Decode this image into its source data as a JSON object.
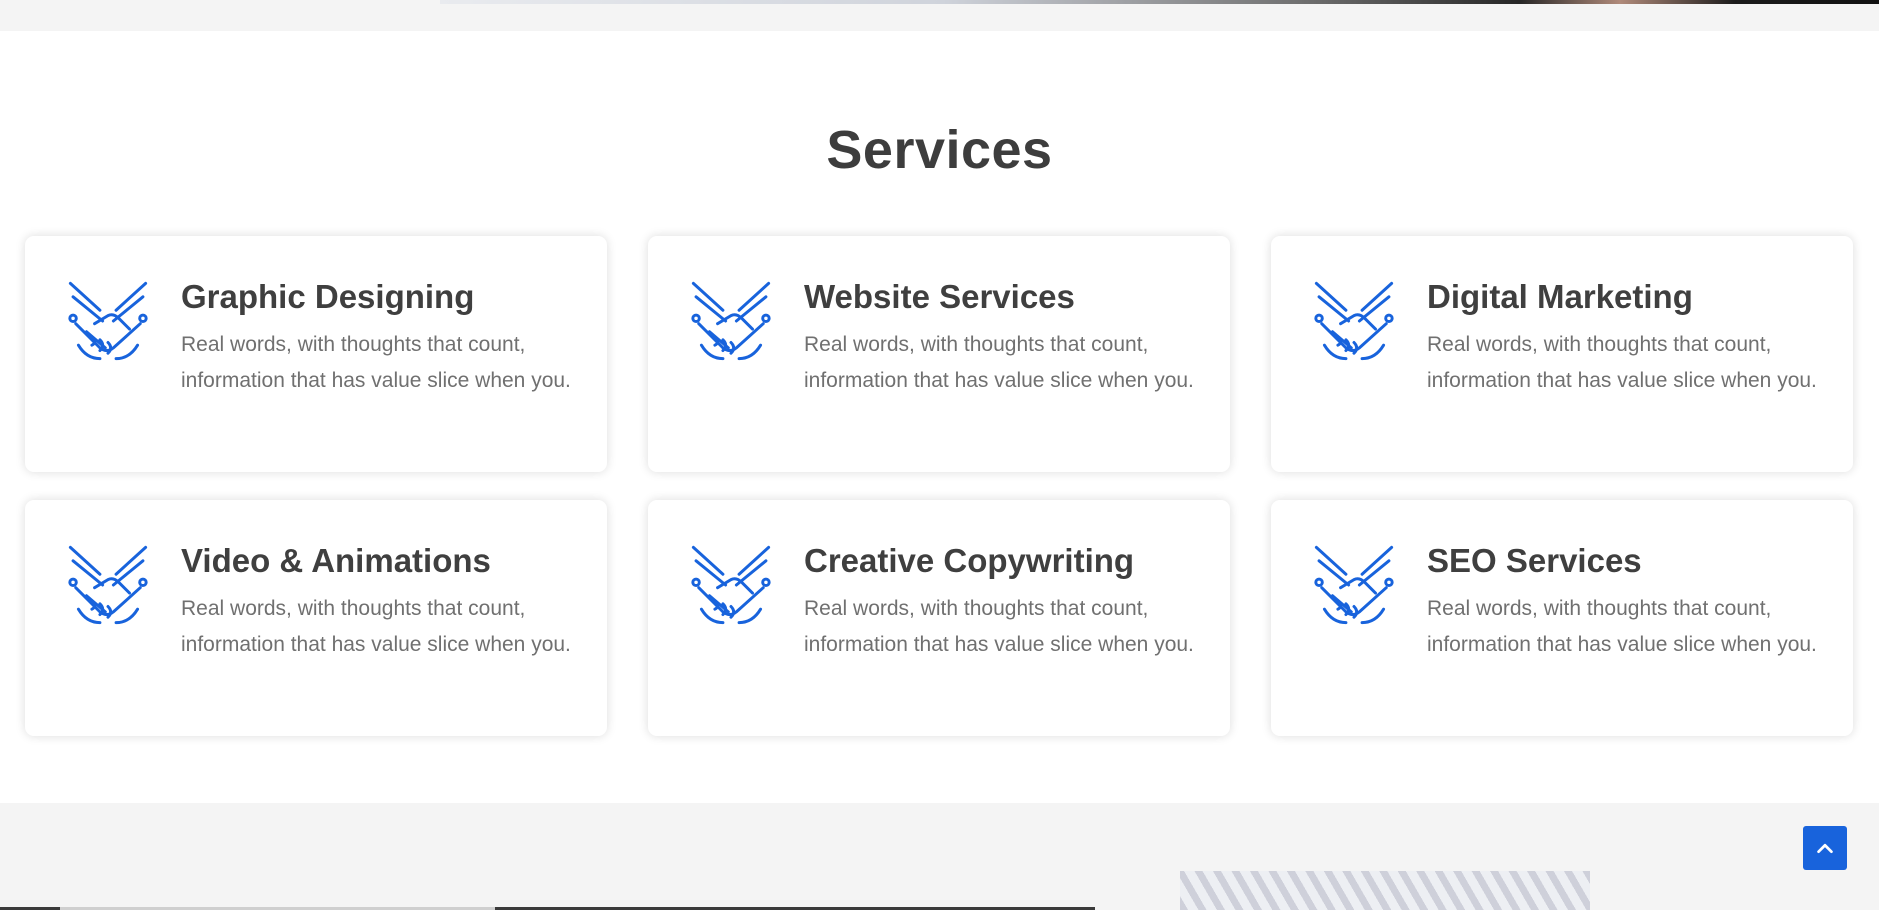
{
  "section": {
    "title": "Services"
  },
  "services": [
    {
      "title": "Graphic Designing",
      "description": "Real words, with thoughts that count, information that has value slice when you.",
      "icon": "handshake-icon"
    },
    {
      "title": "Website Services",
      "description": "Real words, with thoughts that count, information that has value slice when you.",
      "icon": "handshake-icon"
    },
    {
      "title": "Digital Marketing",
      "description": "Real words, with thoughts that count, information that has value slice when you.",
      "icon": "handshake-icon"
    },
    {
      "title": "Video & Animations",
      "description": "Real words, with thoughts that count, information that has value slice when you.",
      "icon": "handshake-icon"
    },
    {
      "title": "Creative Copywriting",
      "description": "Real words, with thoughts that count, information that has value slice when you.",
      "icon": "handshake-icon"
    },
    {
      "title": "SEO Services",
      "description": "Real words, with thoughts that count, information that has value slice when you.",
      "icon": "handshake-icon"
    }
  ],
  "back_to_top": {
    "icon": "chevron-up-icon"
  },
  "colors": {
    "accent": "#1863dc",
    "heading": "#3d3d3d",
    "body_text": "#707070",
    "band_background": "#f4f4f4"
  }
}
